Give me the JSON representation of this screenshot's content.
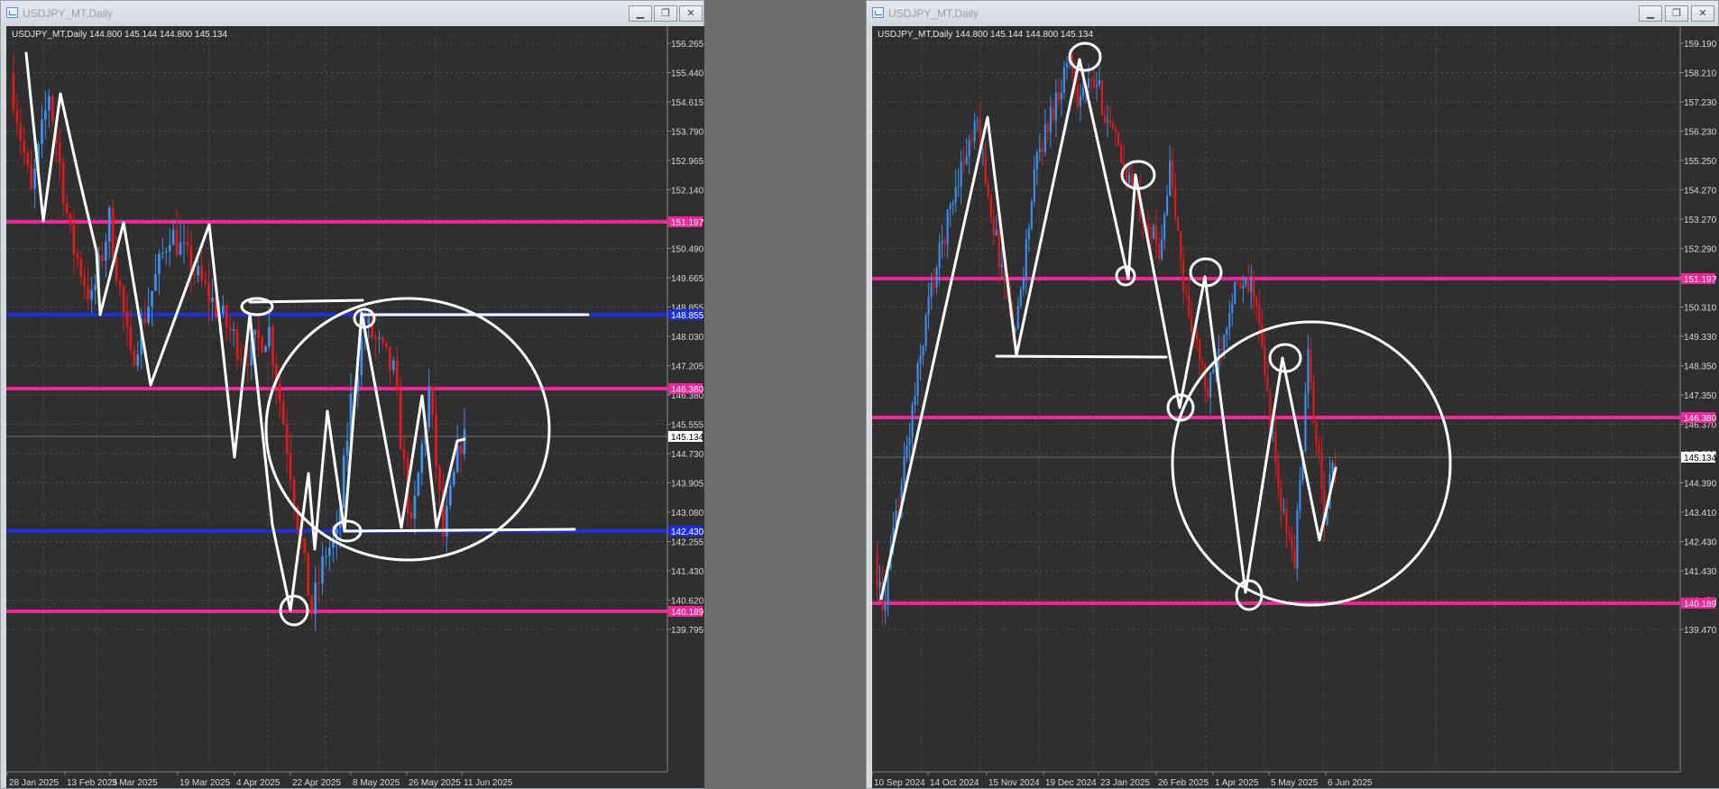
{
  "colors": {
    "background": "#2f2f2f",
    "grid": "#4a4a4a",
    "bull": "#3d8ff0",
    "bear": "#e01b1b",
    "magenta_line": "#f0259a",
    "blue_line": "#1a2fe0",
    "annotation": "#ffffff"
  },
  "windows": [
    {
      "title": "USDJPY_MT,Daily",
      "chart_header": "USDJPY_MT,Daily  144.800 145.144 144.800 145.134",
      "minimize_icon": "minimize-icon",
      "maximize_icon": "maximize-icon",
      "close_icon": "close-icon",
      "price_labels": [
        "156.265",
        "155.440",
        "154.615",
        "153.790",
        "152.965",
        "152.140",
        "151.315",
        "150.490",
        "149.665",
        "148.855",
        "148.030",
        "147.205",
        "146.380",
        "145.555",
        "144.730",
        "143.905",
        "143.080",
        "142.255",
        "141.430",
        "140.620",
        "139.795"
      ],
      "date_labels": [
        "28 Jan 2025",
        "13 Feb 2025",
        "3 Mar 2025",
        "19 Mar 2025",
        "4 Apr 2025",
        "22 Apr 2025",
        "8 May 2025",
        "26 May 2025",
        "11 Jun 2025"
      ],
      "current_price": "145.134",
      "level_tags": [
        {
          "text": "151.197",
          "color": "magenta"
        },
        {
          "text": "148.855",
          "color": "blue"
        },
        {
          "text": "146.380",
          "color": "magenta"
        },
        {
          "text": "142.430",
          "color": "blue"
        },
        {
          "text": "140.189",
          "color": "magenta"
        }
      ]
    },
    {
      "title": "USDJPY_MT,Daily",
      "chart_header": "USDJPY_MT,Daily  144.800 145.144 144.800 145.134",
      "minimize_icon": "minimize-icon",
      "maximize_icon": "maximize-icon",
      "close_icon": "close-icon",
      "price_labels": [
        "159.190",
        "158.210",
        "157.230",
        "156.230",
        "155.250",
        "154.270",
        "153.270",
        "152.290",
        "151.310",
        "150.310",
        "149.330",
        "148.350",
        "147.350",
        "146.370",
        "145.390",
        "144.390",
        "143.410",
        "142.430",
        "141.430",
        "140.450",
        "139.470"
      ],
      "date_labels": [
        "10 Sep 2024",
        "14 Oct 2024",
        "15 Nov 2024",
        "19 Dec 2024",
        "23 Jan 2025",
        "26 Feb 2025",
        "1 Apr 2025",
        "5 May 2025",
        "6 Jun 2025"
      ],
      "current_price": "145.134",
      "level_tags": [
        {
          "text": "151.197",
          "color": "magenta"
        },
        {
          "text": "146.380",
          "color": "magenta"
        },
        {
          "text": "140.189",
          "color": "magenta"
        }
      ]
    }
  ]
}
